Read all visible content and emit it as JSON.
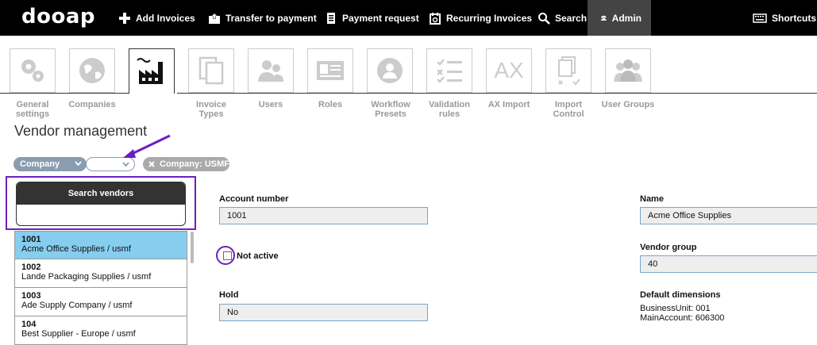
{
  "app": {
    "logo": "dooap"
  },
  "nav": [
    {
      "id": "add",
      "label": "Add Invoices",
      "icon": "plus-icon"
    },
    {
      "id": "transfer",
      "label": "Transfer to payment",
      "icon": "transfer-icon"
    },
    {
      "id": "payreq",
      "label": "Payment request",
      "icon": "document-icon"
    },
    {
      "id": "recurring",
      "label": "Recurring Invoices",
      "icon": "recurring-icon"
    },
    {
      "id": "search",
      "label": "Search",
      "icon": "search-icon"
    },
    {
      "id": "admin",
      "label": "Admin",
      "icon": "users-icon"
    },
    {
      "id": "shortcuts",
      "label": "Shortcuts",
      "icon": "keyboard-icon"
    }
  ],
  "admin_tiles": [
    {
      "label": "General settings",
      "icon": "gears-icon"
    },
    {
      "label": "Companies",
      "icon": "globe-icon"
    },
    {
      "label": "",
      "icon": "factory-icon",
      "selected": true
    },
    {
      "label": "Invoice Types",
      "icon": "documents-icon"
    },
    {
      "label": "Users",
      "icon": "users-icon"
    },
    {
      "label": "Roles",
      "icon": "id-card-icon"
    },
    {
      "label": "Workflow Presets",
      "icon": "workflow-icon"
    },
    {
      "label": "Validation rules",
      "icon": "checklist-icon"
    },
    {
      "label": "AX Import",
      "icon": "ax-icon"
    },
    {
      "label": "Import Control",
      "icon": "import-icon"
    },
    {
      "label": "User Groups",
      "icon": "user-groups-icon"
    }
  ],
  "ax_text": "AX",
  "page_title": "Vendor management",
  "filter": {
    "field": "Company",
    "value": "",
    "chip": "Company: USMF"
  },
  "search": {
    "header": "Search vendors",
    "value": ""
  },
  "vendors": [
    {
      "number": "1001",
      "name": "Acme Office Supplies / usmf",
      "selected": true
    },
    {
      "number": "1002",
      "name": "Lande Packaging Supplies / usmf"
    },
    {
      "number": "1003",
      "name": "Ade Supply Company / usmf"
    },
    {
      "number": "104",
      "name": "Best Supplier - Europe / usmf"
    }
  ],
  "detail": {
    "account_label": "Account number",
    "account_value": "1001",
    "not_active_label": "Not active",
    "not_active_checked": false,
    "hold_label": "Hold",
    "hold_value": "No",
    "name_label": "Name",
    "name_value": "Acme Office Supplies",
    "vendor_group_label": "Vendor group",
    "vendor_group_value": "40",
    "default_dimensions_label": "Default dimensions",
    "dimensions": [
      "BusinessUnit: 001",
      "MainAccount: 606300"
    ]
  },
  "colors": {
    "accent": "#6a1fc2",
    "selected_row": "#86cdee",
    "topbar": "#000000"
  }
}
